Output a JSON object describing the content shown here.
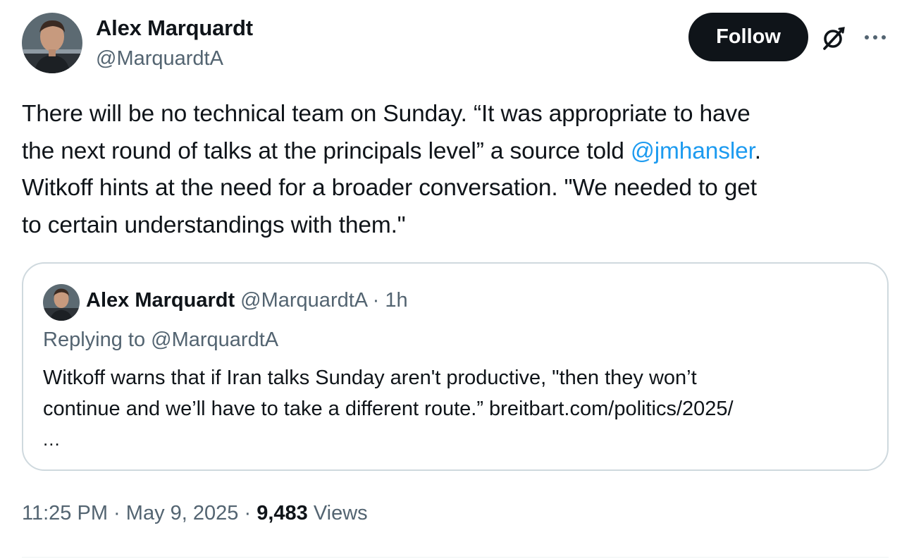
{
  "author": {
    "name": "Alex Marquardt",
    "handle": "@MarquardtA"
  },
  "follow_label": "Follow",
  "icons": {
    "grok": "grok-icon",
    "more": "more-icon"
  },
  "tweet": {
    "line1": "There will be no technical team on Sunday. “It was appropriate to have",
    "line2_pre": "the next round of talks at the principals level” a source told ",
    "mention": "@jmhansler",
    "line2_post": ".",
    "line3": "Witkoff hints at the need for a broader conversation. \"We needed to get",
    "line4": "to certain understandings with them.\""
  },
  "quote": {
    "name": "Alex Marquardt",
    "handle": "@MarquardtA",
    "separator": "·",
    "time": "1h",
    "replying_to": "Replying to @MarquardtA",
    "line1": "Witkoff warns that if Iran talks Sunday aren't productive, \"then they won’t",
    "line2": "continue and we’ll have to take a different route.” breitbart.com/politics/2025/",
    "ellipsis": "..."
  },
  "meta": {
    "time": "11:25 PM",
    "sep1": "·",
    "date": "May 9, 2025",
    "sep2": "·",
    "views_count": "9,483",
    "views_label": "Views"
  },
  "colors": {
    "text": "#0f1419",
    "secondary": "#536471",
    "link": "#1d9bf0",
    "border": "#cfd9de",
    "button_bg": "#0f1419"
  }
}
